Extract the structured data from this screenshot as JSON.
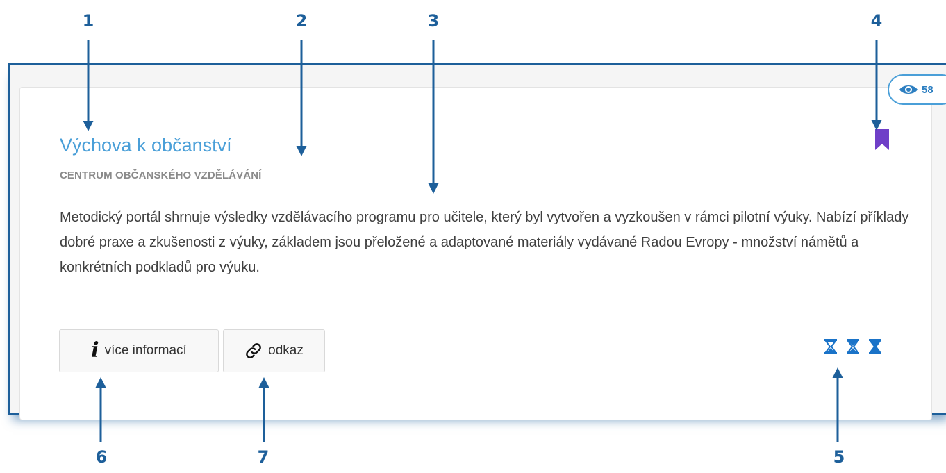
{
  "callouts": [
    "1",
    "2",
    "3",
    "4",
    "5",
    "6",
    "7"
  ],
  "card": {
    "title": "Výchova k občanství",
    "organization": "CENTRUM OBČANSKÉHO VZDĚLÁVÁNÍ",
    "description": "Metodický portál shrnuje výsledky vzdělávacího programu pro učitele, který byl vytvořen a vyzkoušen v rámci pilotní výuky. Nabízí příklady dobré praxe a zkušenosti z výuky, základem jsou přeložené a adaptované materiály vydávané Radou Evropy - množství námětů a konkrétních podkladů pro výuku.",
    "views": "58",
    "buttons": {
      "more_info_label": "více informací",
      "link_label": "odkaz"
    },
    "time_level": 3
  },
  "icons": {
    "views": "eye-icon",
    "bookmark": "bookmark-icon",
    "info": "info-icon",
    "link": "link-icon",
    "time": "hourglass-icon"
  },
  "colors": {
    "callout": "#1d5f9a",
    "title": "#4a9fd8",
    "bookmark": "#6f3fc8",
    "hourglass": "#1a73c8"
  }
}
